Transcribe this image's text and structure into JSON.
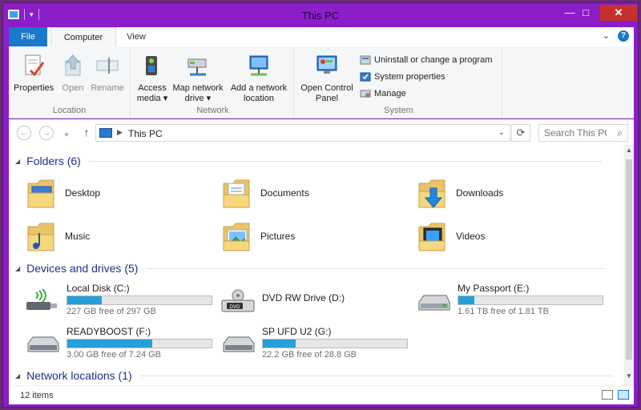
{
  "window": {
    "title": "This PC",
    "controls": {
      "minimize": "—",
      "maximize": "□",
      "close": "✕"
    }
  },
  "ribbon": {
    "tabs": [
      "File",
      "Computer",
      "View"
    ],
    "help": "?",
    "groups": {
      "location": {
        "label": "Location",
        "buttons": [
          {
            "label": "Properties",
            "enabled": true
          },
          {
            "label": "Open",
            "enabled": false
          },
          {
            "label": "Rename",
            "enabled": false
          }
        ]
      },
      "network": {
        "label": "Network",
        "buttons": [
          {
            "line1": "Access",
            "line2": "media ▾"
          },
          {
            "line1": "Map network",
            "line2": "drive ▾"
          },
          {
            "line1": "Add a network",
            "line2": "location"
          }
        ]
      },
      "system": {
        "label": "System",
        "open_control_panel": {
          "line1": "Open Control",
          "line2": "Panel"
        },
        "items": [
          "Uninstall or change a program",
          "System properties",
          "Manage"
        ]
      }
    }
  },
  "address": {
    "path": "This PC",
    "search_placeholder": "Search This PC"
  },
  "sections": {
    "folders": {
      "title": "Folders (6)",
      "items": [
        "Desktop",
        "Documents",
        "Downloads",
        "Music",
        "Pictures",
        "Videos"
      ]
    },
    "drives": {
      "title": "Devices and drives (5)",
      "items": [
        {
          "name": "Local Disk (C:)",
          "free": "227 GB free of 297 GB",
          "used_fraction": 0.24,
          "icon": "usb-wireless-drive-icon"
        },
        {
          "name": "DVD RW Drive (D:)",
          "free": "",
          "used_fraction": null,
          "icon": "dvd-drive-icon"
        },
        {
          "name": "My Passport (E:)",
          "free": "1.61 TB free of 1.81 TB",
          "used_fraction": 0.11,
          "icon": "external-drive-icon"
        },
        {
          "name": "READYBOOST (F:)",
          "free": "3.00 GB free of 7.24 GB",
          "used_fraction": 0.59,
          "icon": "removable-drive-icon"
        },
        {
          "name": "SP UFD U2 (G:)",
          "free": "22.2 GB free of 28.8 GB",
          "used_fraction": 0.23,
          "icon": "removable-drive-icon"
        }
      ]
    },
    "network": {
      "title": "Network locations (1)"
    }
  },
  "status": {
    "count": "12 items"
  },
  "colors": {
    "title_bar": "#8b1ec9",
    "file_tab": "#1979ca",
    "section_header": "#1e3287",
    "drive_fill": "#26a0da",
    "close_button": "#c7302c"
  }
}
